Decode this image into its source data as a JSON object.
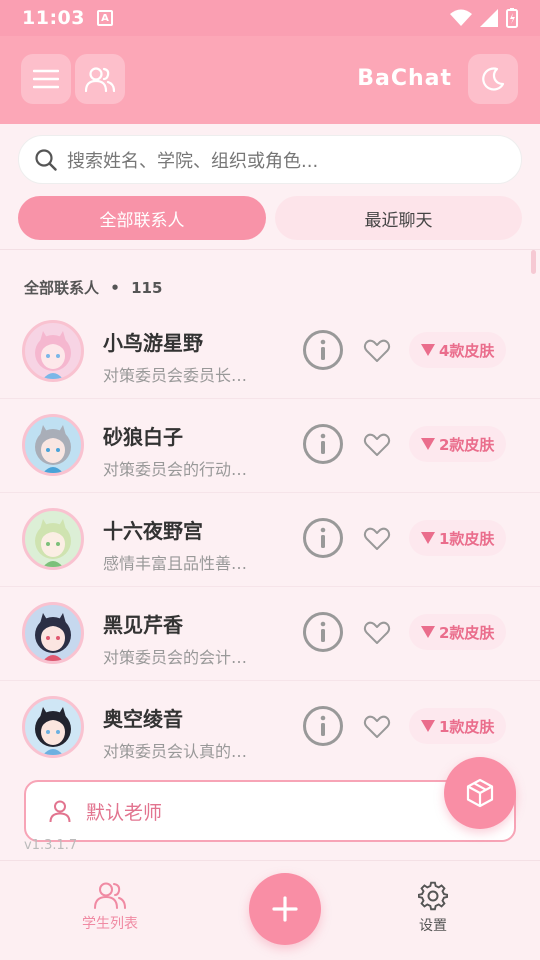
{
  "status_bar": {
    "time": "11:03",
    "badge": "A"
  },
  "app_bar": {
    "title": "BaChat"
  },
  "search": {
    "placeholder": "搜索姓名、学院、组织或角色..."
  },
  "tabs": [
    {
      "label": "全部联系人",
      "active": true
    },
    {
      "label": "最近聊天",
      "active": false
    }
  ],
  "list": {
    "section_title": "全部联系人",
    "separator": "•",
    "count": "115",
    "contacts": [
      {
        "name": "小鸟游星野",
        "desc": "对策委员会委员长…",
        "skins": "4款皮肤",
        "avatar": "pink"
      },
      {
        "name": "砂狼白子",
        "desc": "对策委员会的行动…",
        "skins": "2款皮肤",
        "avatar": "grey"
      },
      {
        "name": "十六夜野宫",
        "desc": "感情丰富且品性善…",
        "skins": "1款皮肤",
        "avatar": "green"
      },
      {
        "name": "黑见芹香",
        "desc": "对策委员会的会计…",
        "skins": "2款皮肤",
        "avatar": "dark"
      },
      {
        "name": "奥空绫音",
        "desc": "对策委员会认真的…",
        "skins": "1款皮肤",
        "avatar": "black"
      }
    ]
  },
  "teacher": {
    "label": "默认老师"
  },
  "version": "v1.3.1.7",
  "bottom_nav": {
    "students": "学生列表",
    "settings": "设置"
  },
  "colors": {
    "accent": "#f98ea5",
    "header": "#fca7b7",
    "background": "#fdf0f3"
  }
}
